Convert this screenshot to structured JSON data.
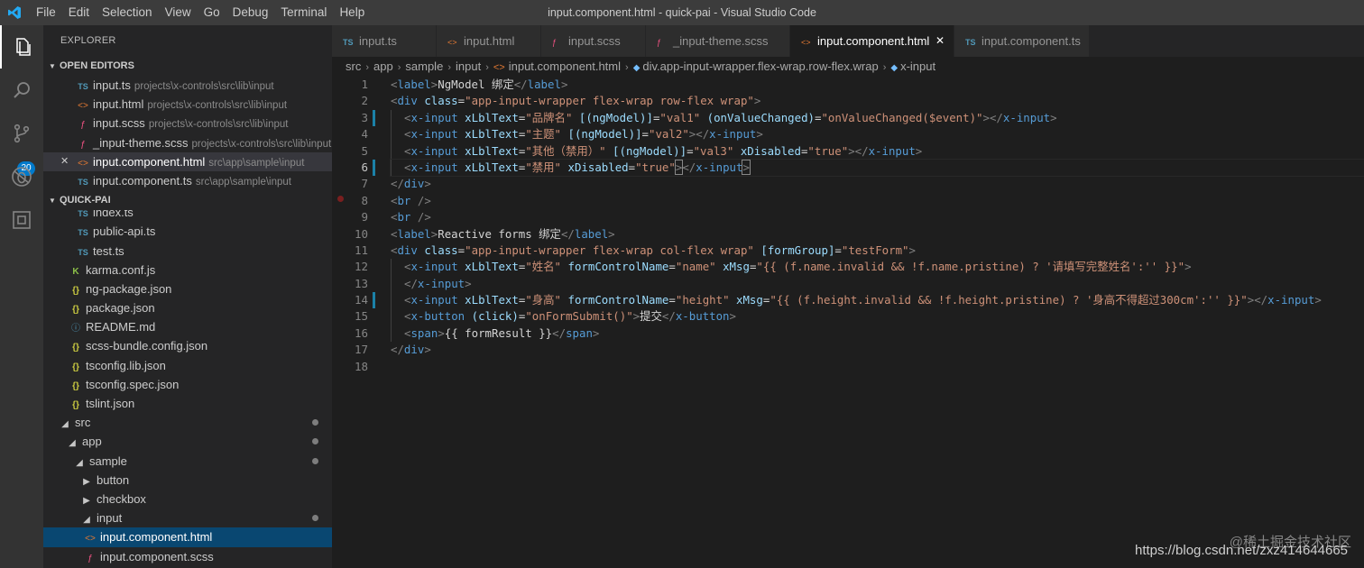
{
  "window": {
    "menus": [
      "File",
      "Edit",
      "Selection",
      "View",
      "Go",
      "Debug",
      "Terminal",
      "Help"
    ],
    "title": "input.component.html - quick-pai - Visual Studio Code"
  },
  "activity_bar": {
    "items": [
      "explorer-icon",
      "search-icon",
      "source-control-icon",
      "debug-icon",
      "extensions-icon"
    ],
    "source_control_badge": "20"
  },
  "sidebar": {
    "title": "EXPLORER",
    "open_editors": {
      "header": "OPEN EDITORS",
      "items": [
        {
          "icon": "TS",
          "name": "input.ts",
          "path": "projects\\x-controls\\src\\lib\\input"
        },
        {
          "icon": "<>",
          "name": "input.html",
          "path": "projects\\x-controls\\src\\lib\\input"
        },
        {
          "icon": "scss",
          "name": "input.scss",
          "path": "projects\\x-controls\\src\\lib\\input"
        },
        {
          "icon": "scss",
          "name": "_input-theme.scss",
          "path": "projects\\x-controls\\src\\lib\\input"
        },
        {
          "icon": "<>",
          "name": "input.component.html",
          "path": "src\\app\\sample\\input"
        },
        {
          "icon": "TS",
          "name": "input.component.ts",
          "path": "src\\app\\sample\\input"
        }
      ]
    },
    "project": {
      "header": "QUICK-PAI",
      "items": [
        {
          "icon": "TS",
          "name": "index.ts"
        },
        {
          "icon": "TS",
          "name": "public-api.ts"
        },
        {
          "icon": "TS",
          "name": "test.ts"
        },
        {
          "icon": "K",
          "name": "karma.conf.js"
        },
        {
          "icon": "{}",
          "name": "ng-package.json"
        },
        {
          "icon": "{}",
          "name": "package.json"
        },
        {
          "icon": "i",
          "name": "README.md"
        },
        {
          "icon": "{}",
          "name": "scss-bundle.config.json"
        },
        {
          "icon": "{}",
          "name": "tsconfig.lib.json"
        },
        {
          "icon": "{}",
          "name": "tsconfig.spec.json"
        },
        {
          "icon": "{}",
          "name": "tslint.json"
        },
        {
          "icon": "folder-open",
          "name": "src"
        },
        {
          "icon": "folder-open",
          "name": "app"
        },
        {
          "icon": "folder-open",
          "name": "sample"
        },
        {
          "icon": "folder-closed",
          "name": "button"
        },
        {
          "icon": "folder-closed",
          "name": "checkbox"
        },
        {
          "icon": "folder-open",
          "name": "input"
        },
        {
          "icon": "<>",
          "name": "input.component.html"
        },
        {
          "icon": "scss",
          "name": "input.component.scss"
        }
      ]
    }
  },
  "tabs": [
    {
      "icon": "TS",
      "label": "input.ts"
    },
    {
      "icon": "<>",
      "label": "input.html"
    },
    {
      "icon": "scss",
      "label": "input.scss"
    },
    {
      "icon": "scss",
      "label": "_input-theme.scss"
    },
    {
      "icon": "<>",
      "label": "input.component.html",
      "active": true
    },
    {
      "icon": "TS",
      "label": "input.component.ts"
    }
  ],
  "breadcrumb": [
    "src",
    "app",
    "sample",
    "input",
    "input.component.html",
    "div.app-input-wrapper.flex-wrap.row-flex.wrap",
    "x-input"
  ],
  "editor": {
    "line_numbers": [
      "1",
      "2",
      "3",
      "4",
      "5",
      "6",
      "7",
      "8",
      "9",
      "10",
      "11",
      "12",
      "13",
      "14",
      "15",
      "16",
      "17",
      "18"
    ],
    "current_line": "6"
  },
  "watermark": {
    "site": "@稀土掘金技术社区",
    "url": "https://blog.csdn.net/zxz414644665"
  },
  "colors": {
    "tag": "#569cd6",
    "attribute": "#9cdcfe",
    "string": "#ce9178",
    "selection": "#094771",
    "badge": "#007acc"
  }
}
